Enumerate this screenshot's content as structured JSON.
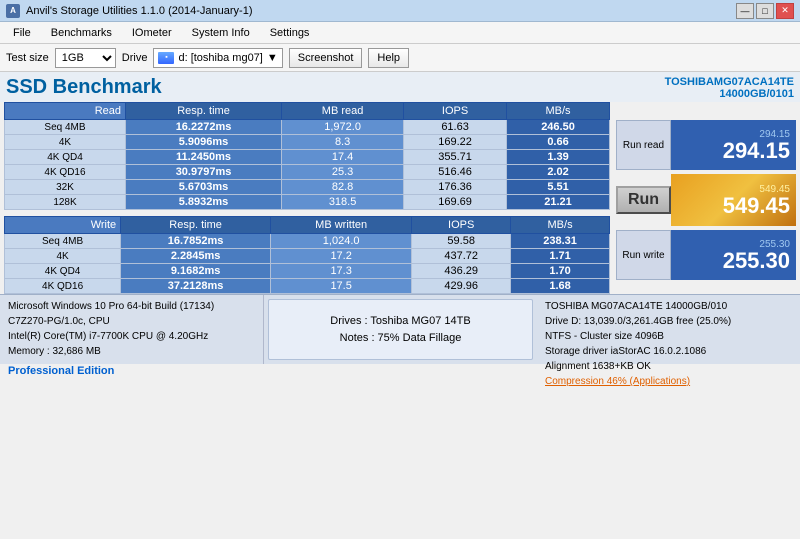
{
  "titleBar": {
    "title": "Anvil's Storage Utilities 1.1.0 (2014-January-1)",
    "iconLabel": "A",
    "minimizeBtn": "—",
    "maximizeBtn": "□",
    "closeBtn": "✕"
  },
  "menuBar": {
    "items": [
      "File",
      "Benchmarks",
      "IOmeter",
      "System Info",
      "Settings",
      "Test size",
      "Drive",
      "Screenshot",
      "Help"
    ]
  },
  "toolbar": {
    "testSizeLabel": "Test size",
    "testSizeValue": "1GB",
    "driveLabel": "Drive",
    "driveIcon": "HDD",
    "driveValue": "d: [toshiba mg07]",
    "screenshotBtn": "Screenshot",
    "helpBtn": "Help"
  },
  "ssdBenchmark": {
    "title": "SSD Benchmark",
    "driveInfo1": "TOSHIBAMG07ACA14TE",
    "driveInfo2": "14000GB/0101"
  },
  "readTable": {
    "headers": [
      "Read",
      "Resp. time",
      "MB read",
      "IOPS",
      "MB/s"
    ],
    "rows": [
      {
        "label": "Seq 4MB",
        "resp": "16.2272ms",
        "mb": "1,972.0",
        "iops": "61.63",
        "mbs": "246.50"
      },
      {
        "label": "4K",
        "resp": "5.9096ms",
        "mb": "8.3",
        "iops": "169.22",
        "mbs": "0.66"
      },
      {
        "label": "4K QD4",
        "resp": "11.2450ms",
        "mb": "17.4",
        "iops": "355.71",
        "mbs": "1.39"
      },
      {
        "label": "4K QD16",
        "resp": "30.9797ms",
        "mb": "25.3",
        "iops": "516.46",
        "mbs": "2.02"
      },
      {
        "label": "32K",
        "resp": "5.6703ms",
        "mb": "82.8",
        "iops": "176.36",
        "mbs": "5.51"
      },
      {
        "label": "128K",
        "resp": "5.8932ms",
        "mb": "318.5",
        "iops": "169.69",
        "mbs": "21.21"
      }
    ]
  },
  "writeTable": {
    "headers": [
      "Write",
      "Resp. time",
      "MB written",
      "IOPS",
      "MB/s"
    ],
    "rows": [
      {
        "label": "Seq 4MB",
        "resp": "16.7852ms",
        "mb": "1,024.0",
        "iops": "59.58",
        "mbs": "238.31"
      },
      {
        "label": "4K",
        "resp": "2.2845ms",
        "mb": "17.2",
        "iops": "437.72",
        "mbs": "1.71"
      },
      {
        "label": "4K QD4",
        "resp": "9.1682ms",
        "mb": "17.3",
        "iops": "436.29",
        "mbs": "1.70"
      },
      {
        "label": "4K QD16",
        "resp": "37.2128ms",
        "mb": "17.5",
        "iops": "429.96",
        "mbs": "1.68"
      }
    ]
  },
  "scores": {
    "readLabel": "Run read",
    "readSmall": "294.15",
    "readLarge": "294.15",
    "runLabel": "Run",
    "writeLabel": "Run write",
    "writeSmall": "255.30",
    "writeLarge": "255.30",
    "totalSmall": "549.45",
    "totalLarge": "549.45"
  },
  "statusBar": {
    "col1": {
      "line1": "Microsoft Windows 10 Pro 64-bit Build (17134)",
      "line2": "C7Z270-PG/1.0c, CPU",
      "line3": "Intel(R) Core(TM) i7-7700K CPU @ 4.20GHz",
      "line4": "Memory : 32,686 MB",
      "proEdition": "Professional Edition"
    },
    "col2": {
      "line1": "Drives : Toshiba MG07 14TB",
      "line2": "Notes : 75% Data Fillage"
    },
    "col3": {
      "line1": "TOSHIBA MG07ACA14TE 14000GB/010",
      "line2": "Drive D: 13,039.0/3,261.4GB free (25.0%)",
      "line3": "NTFS - Cluster size 4096B",
      "line4": "Storage driver  iaStorAC 16.0.2.1086",
      "line5": "Alignment 1638+KB OK",
      "line6": "Compression 46% (Applications)"
    }
  }
}
